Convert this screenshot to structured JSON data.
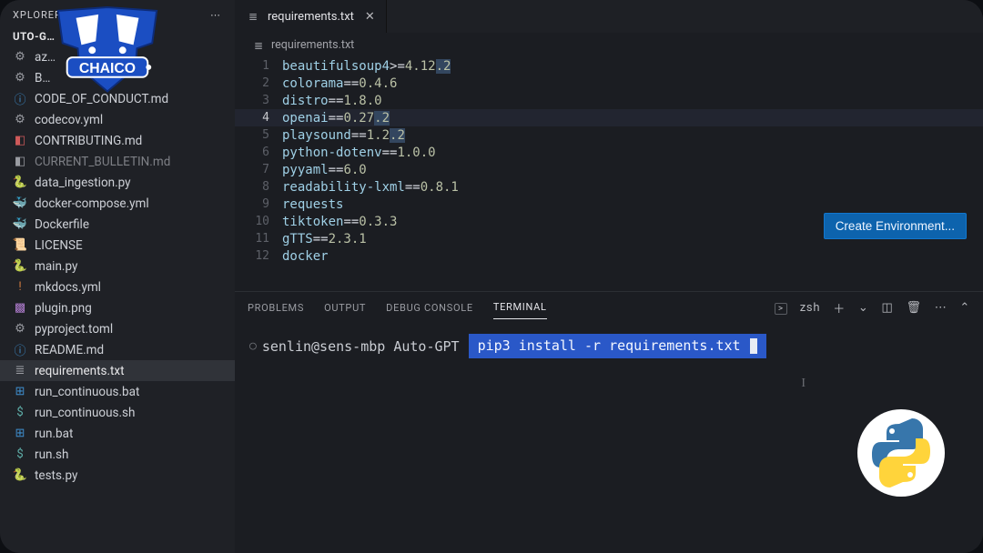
{
  "sidebar": {
    "header": "XPLORER",
    "root": "UTO-G…",
    "files": [
      {
        "name": "az…",
        "icon": "gear",
        "color": "ic-gray"
      },
      {
        "name": "B…",
        "icon": "gear",
        "color": "ic-gray"
      },
      {
        "name": "CODE_OF_CONDUCT.md",
        "icon": "info",
        "color": "ic-blue"
      },
      {
        "name": "codecov.yml",
        "icon": "gear",
        "color": "ic-gray"
      },
      {
        "name": "CONTRIBUTING.md",
        "icon": "doc",
        "color": "ic-red"
      },
      {
        "name": "CURRENT_BULLETIN.md",
        "icon": "doc",
        "color": "ic-gray",
        "dim": true
      },
      {
        "name": "data_ingestion.py",
        "icon": "py",
        "color": "ic-blue"
      },
      {
        "name": "docker-compose.yml",
        "icon": "docker",
        "color": "ic-teal"
      },
      {
        "name": "Dockerfile",
        "icon": "docker",
        "color": "ic-blue"
      },
      {
        "name": "LICENSE",
        "icon": "cert",
        "color": "ic-yellow"
      },
      {
        "name": "main.py",
        "icon": "py",
        "color": "ic-blue"
      },
      {
        "name": "mkdocs.yml",
        "icon": "yml",
        "color": "ic-orange"
      },
      {
        "name": "plugin.png",
        "icon": "img",
        "color": "ic-purple"
      },
      {
        "name": "pyproject.toml",
        "icon": "gear",
        "color": "ic-gray"
      },
      {
        "name": "README.md",
        "icon": "info",
        "color": "ic-blue"
      },
      {
        "name": "requirements.txt",
        "icon": "list",
        "color": "ic-gray",
        "active": true
      },
      {
        "name": "run_continuous.bat",
        "icon": "win",
        "color": "ic-blue"
      },
      {
        "name": "run_continuous.sh",
        "icon": "sh",
        "color": "ic-teal"
      },
      {
        "name": "run.bat",
        "icon": "win",
        "color": "ic-blue"
      },
      {
        "name": "run.sh",
        "icon": "sh",
        "color": "ic-teal"
      },
      {
        "name": "tests.py",
        "icon": "py",
        "color": "ic-blue"
      }
    ]
  },
  "tabs": {
    "active_file": "requirements.txt",
    "breadcrumb": "requirements.txt"
  },
  "editor": {
    "filename": "requirements.txt",
    "lines": [
      {
        "n": 1,
        "name": "beautifulsoup4",
        "op": ">=",
        "ver": "4.12.2",
        "sel": false
      },
      {
        "n": 2,
        "name": "colorama",
        "op": "==",
        "ver": "0.4.6"
      },
      {
        "n": 3,
        "name": "distro",
        "op": "==",
        "ver": "1.8.0"
      },
      {
        "n": 4,
        "name": "openai",
        "op": "==",
        "ver": "0.27.2",
        "hl": true
      },
      {
        "n": 5,
        "name": "playsound",
        "op": "==",
        "ver": "1.2.2"
      },
      {
        "n": 6,
        "name": "python-dotenv",
        "op": "==",
        "ver": "1.0.0"
      },
      {
        "n": 7,
        "name": "pyyaml",
        "op": "==",
        "ver": "6.0"
      },
      {
        "n": 8,
        "name": "readability-lxml",
        "op": "==",
        "ver": "0.8.1"
      },
      {
        "n": 9,
        "name": "requests",
        "op": "",
        "ver": ""
      },
      {
        "n": 10,
        "name": "tiktoken",
        "op": "==",
        "ver": "0.3.3"
      },
      {
        "n": 11,
        "name": "gTTS",
        "op": "==",
        "ver": "2.3.1"
      },
      {
        "n": 12,
        "name": "docker",
        "op": "",
        "ver": ""
      }
    ],
    "create_env_label": "Create Environment..."
  },
  "panel": {
    "tabs": {
      "problems": "PROBLEMS",
      "output": "OUTPUT",
      "debug": "DEBUG CONSOLE",
      "terminal": "TERMINAL"
    },
    "active": "terminal",
    "shell": "zsh",
    "prompt": "senlin@sens-mbp Auto-GPT",
    "command": "pip3 install -r requirements.txt"
  },
  "overlay": {
    "logo_text": "CHAICO"
  }
}
